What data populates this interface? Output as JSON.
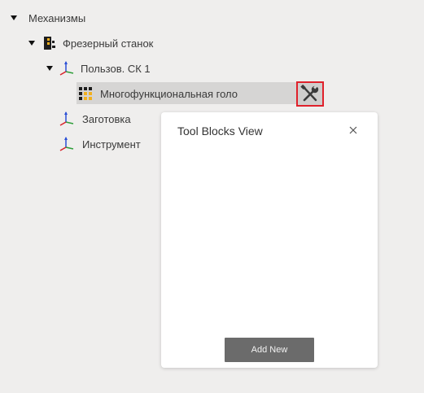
{
  "tree": {
    "root": {
      "label": "Механизмы",
      "icon": "expand-triangle-icon"
    },
    "machine": {
      "label": "Фрезерный станок",
      "icon": "milling-machine-icon"
    },
    "user_cs": {
      "label": "Пользов. СК 1",
      "icon": "coordinate-axes-icon"
    },
    "head": {
      "label": "Многофункциональная голо",
      "icon": "multi-tool-head-icon"
    },
    "workpiece": {
      "label": "Заготовка",
      "icon": "coordinate-axes-icon"
    },
    "tool": {
      "label": "Инструмент",
      "icon": "coordinate-axes-icon"
    }
  },
  "tool_button": {
    "icon": "wrench-screwdriver-icon",
    "highlight_color": "#e0212b"
  },
  "panel": {
    "title": "Tool Blocks View",
    "close_icon": "close-icon",
    "add_button_label": "Add New"
  },
  "colors": {
    "background": "#efeeed",
    "selection": "#d6d5d4",
    "axis_red": "#d8232a",
    "axis_green": "#2e9e3a",
    "axis_blue": "#2a4fd6",
    "icon_yellow": "#f2b01e"
  }
}
